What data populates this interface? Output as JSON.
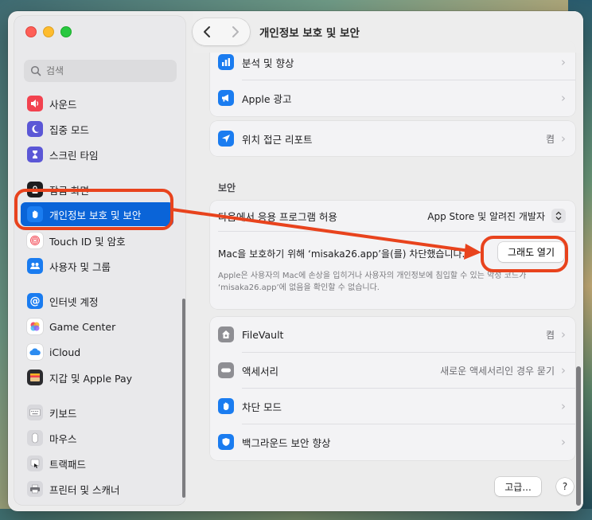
{
  "window": {
    "title": "개인정보 보호 및 보안"
  },
  "sidebar": {
    "search_placeholder": "검색",
    "items": [
      {
        "label": "사운드",
        "icon": "speaker-icon",
        "color": "#f2424f"
      },
      {
        "label": "집중 모드",
        "icon": "moon-icon",
        "color": "#5b57d6"
      },
      {
        "label": "스크린 타임",
        "icon": "hourglass-icon",
        "color": "#5b57d6"
      },
      {
        "label": "잠금 화면",
        "icon": "lock-icon",
        "color": "#1d1d1f"
      },
      {
        "label": "개인정보 보호 및 보안",
        "icon": "hand-icon",
        "color": "#0a64d8",
        "selected": true
      },
      {
        "label": "Touch ID 및 암호",
        "icon": "fingerprint-icon",
        "color": "#ffffff"
      },
      {
        "label": "사용자 및 그룹",
        "icon": "users-icon",
        "color": "#1a7cf0"
      },
      {
        "label": "인터넷 계정",
        "icon": "at-icon",
        "color": "#1a7cf0"
      },
      {
        "label": "Game Center",
        "icon": "game-center-icon",
        "color": "#ffffff"
      },
      {
        "label": "iCloud",
        "icon": "cloud-icon",
        "color": "#ffffff"
      },
      {
        "label": "지갑 및 Apple Pay",
        "icon": "wallet-icon",
        "color": "#2b2b2e"
      },
      {
        "label": "키보드",
        "icon": "keyboard-icon",
        "color": "#8e8e93"
      },
      {
        "label": "마우스",
        "icon": "mouse-icon",
        "color": "#8e8e93"
      },
      {
        "label": "트랙패드",
        "icon": "trackpad-icon",
        "color": "#8e8e93"
      },
      {
        "label": "프린터 및 스캐너",
        "icon": "printer-icon",
        "color": "#8e8e93"
      }
    ]
  },
  "main": {
    "privacy_rows": [
      {
        "label": "분석 및 향상",
        "icon": "chart-icon",
        "color": "#1a7cf0"
      },
      {
        "label": "Apple 광고",
        "icon": "megaphone-icon",
        "color": "#1a7cf0"
      }
    ],
    "location_row": {
      "label": "위치 접근 리포트",
      "value": "켬",
      "icon": "location-icon",
      "color": "#1a7cf0"
    },
    "security_section": "보안",
    "allow_apps": {
      "label": "다음에서 응용 프로그램 허용",
      "value": "App Store 및 알려진 개발자"
    },
    "blocked": {
      "message": "Mac을 보호하기 위해 ‘misaka26.app’을(를) 차단했습니다.",
      "button": "그래도 열기",
      "note_line1": "Apple은 사용자의 Mac에 손상을 입히거나 사용자의 개인정보에 침입할 수 있는 악성 코드가",
      "note_line2": "‘misaka26.app’에 없음을 확인할 수 없습니다."
    },
    "bottom_rows": [
      {
        "label": "FileVault",
        "value": "켬",
        "icon": "house-icon",
        "color": "#8e8e93"
      },
      {
        "label": "액세서리",
        "value": "새로운 액세서리인 경우 묻기",
        "icon": "accessory-icon",
        "color": "#8e8e93"
      },
      {
        "label": "차단 모드",
        "value": "",
        "icon": "hand-icon",
        "color": "#1a7cf0"
      },
      {
        "label": "백그라운드 보안 향상",
        "value": "",
        "icon": "shield-icon",
        "color": "#1a7cf0"
      }
    ],
    "advanced_button": "고급...",
    "help_button": "?"
  }
}
